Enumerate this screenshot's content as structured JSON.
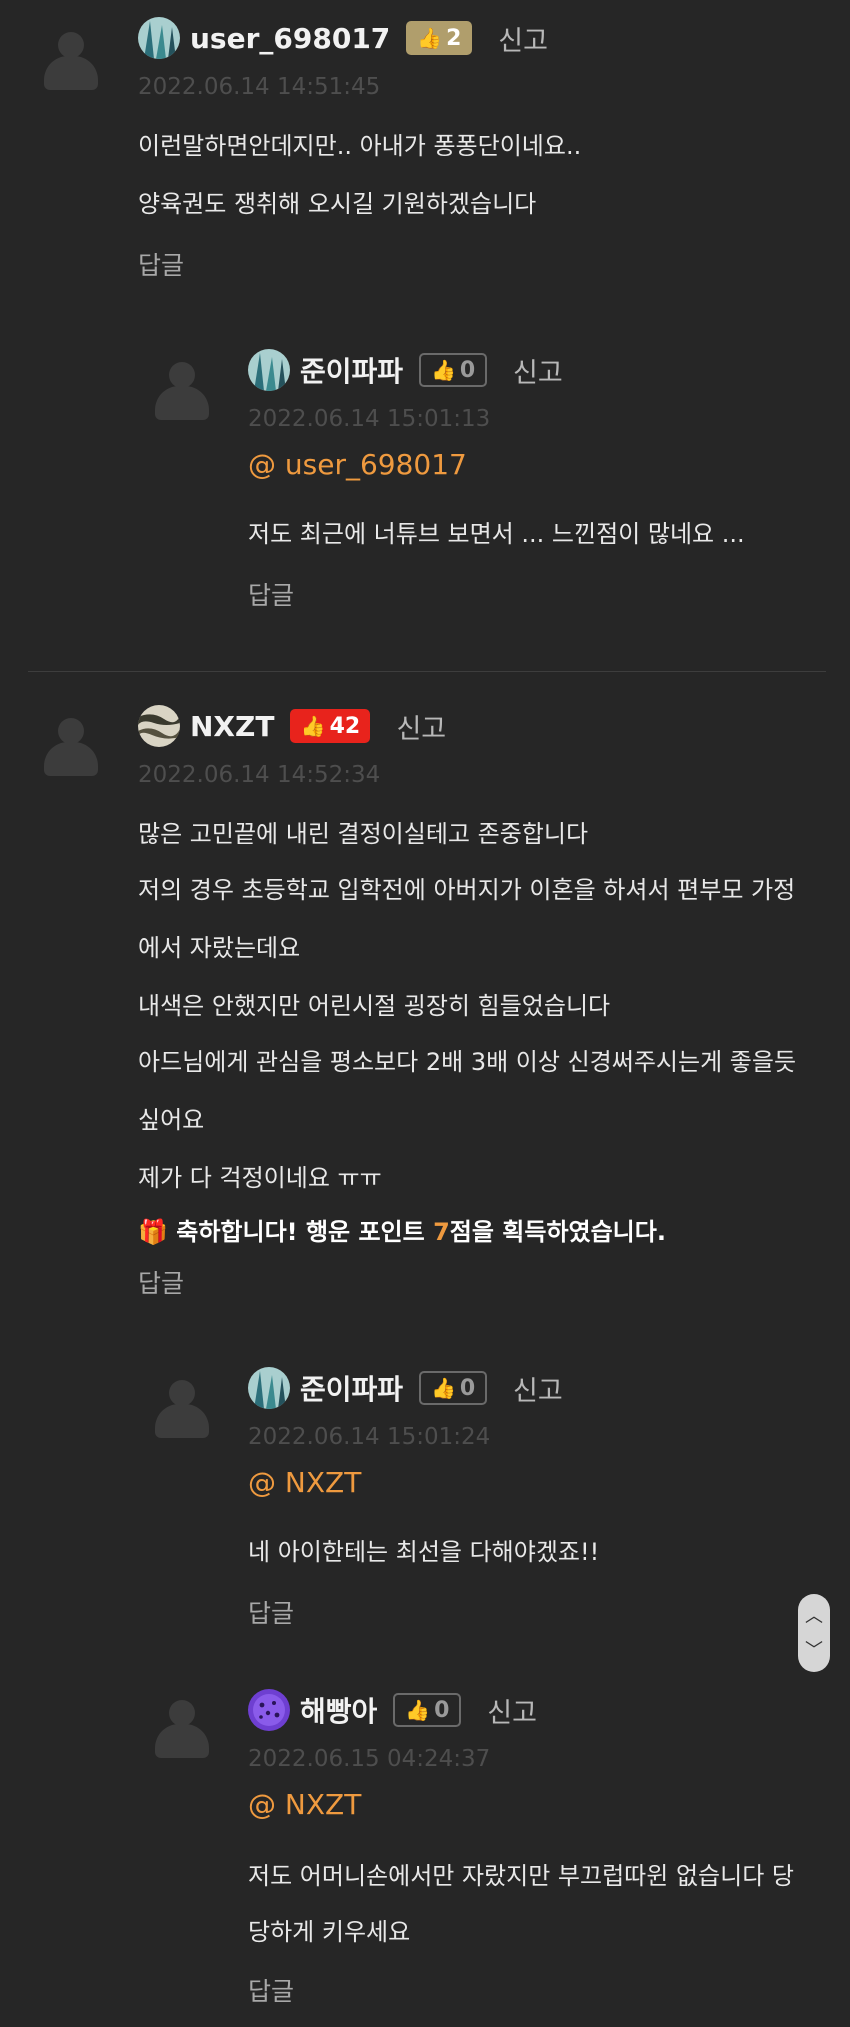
{
  "comments": [
    {
      "username": "user_698017",
      "likes": "2",
      "report": "신고",
      "timestamp": "2022.06.14 14:51:45",
      "lines": [
        "이런말하면안데지만.. 아내가 퐁퐁단이네요..",
        "양육권도 쟁취해 오시길 기원하겠습니다"
      ],
      "reply": "답글"
    },
    {
      "username": "준이파파",
      "likes": "0",
      "report": "신고",
      "timestamp": "2022.06.14 15:01:13",
      "mention": "@ user_698017",
      "lines": [
        "저도 최근에 너튜브 보면서 ... 느낀점이 많네요 ..."
      ],
      "reply": "답글"
    },
    {
      "username": "NXZT",
      "likes": "42",
      "report": "신고",
      "timestamp": "2022.06.14 14:52:34",
      "lines": [
        "많은 고민끝에 내린 결정이실테고 존중합니다",
        "저의 경우 초등학교 입학전에 아버지가 이혼을 하셔서 편부모 가정",
        "에서 자랐는데요",
        "내색은 안했지만 어린시절 굉장히 힘들었습니다",
        "아드님에게 관심을 평소보다 2배 3배 이상 신경써주시는게 좋을듯",
        "싶어요",
        "제가 다 걱정이네요 ㅠㅠ"
      ],
      "notice": {
        "before": "축하합니다! 행운 포인트 ",
        "points": "7",
        "after": "점을 획득하였습니다."
      },
      "reply": "답글"
    },
    {
      "username": "준이파파",
      "likes": "0",
      "report": "신고",
      "timestamp": "2022.06.14 15:01:24",
      "mention": "@ NXZT",
      "lines": [
        "네 아이한테는 최선을 다해야겠죠!!"
      ],
      "reply": "답글"
    },
    {
      "username": "해빵아",
      "likes": "0",
      "report": "신고",
      "timestamp": "2022.06.15 04:24:37",
      "mention": "@ NXZT",
      "lines": [
        "저도 어머니손에서만 자랐지만 부끄럽따윈 없습니다 당",
        "당하게 키우세요"
      ],
      "reply": "답글"
    }
  ],
  "icons": {
    "thumb": "thumbs-up-icon",
    "gift": "gift-icon",
    "scroll_up": "chevron-up-icon",
    "scroll_down": "chevron-down-icon"
  },
  "colors": {
    "background": "#262626",
    "mention": "#ef9a3f",
    "badge_gold": "#b09e6c",
    "badge_red": "#e8231c"
  }
}
